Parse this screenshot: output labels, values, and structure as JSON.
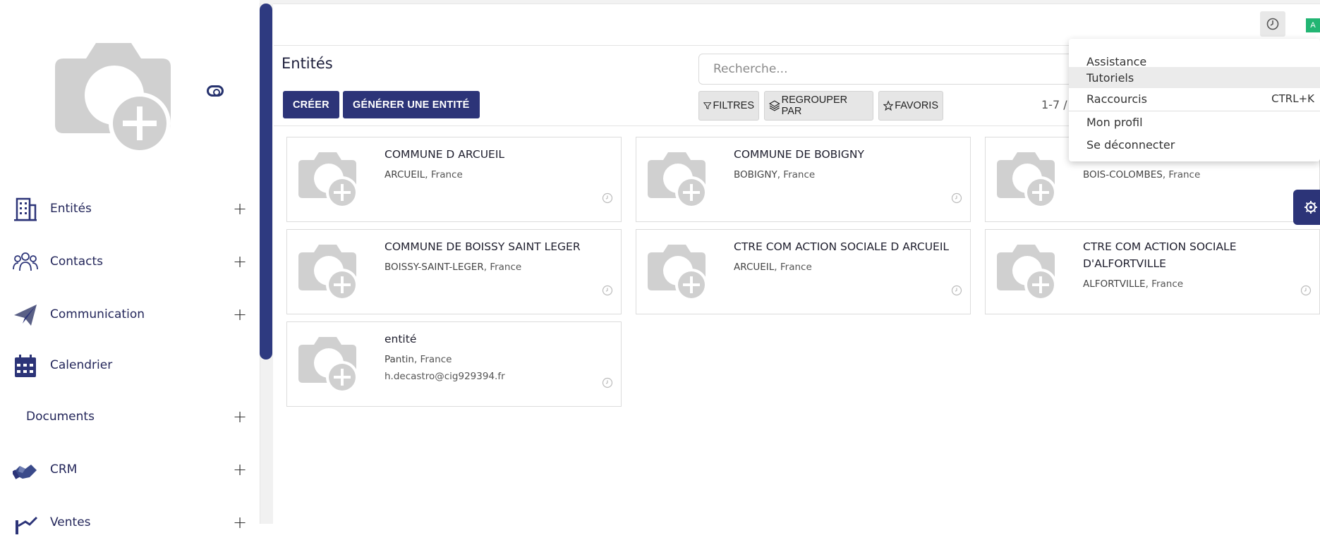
{
  "sidebar": {
    "items": [
      {
        "label": "Entités",
        "icon": "building-icon",
        "has_add": true
      },
      {
        "label": "Contacts",
        "icon": "people-icon",
        "has_add": true
      },
      {
        "label": "Communication",
        "icon": "paper-plane-icon",
        "has_add": true
      },
      {
        "label": "Calendrier",
        "icon": "calendar-icon",
        "has_add": false
      },
      {
        "label": "Documents",
        "icon": "",
        "has_add": true
      },
      {
        "label": "CRM",
        "icon": "handshake-icon",
        "has_add": true
      },
      {
        "label": "Ventes",
        "icon": "chart-icon",
        "has_add": true
      }
    ],
    "add_symbol": "+"
  },
  "main": {
    "title": "Entités",
    "create_label": "CRÉER",
    "generate_label": "GÉNÉRER UNE ENTITÉ",
    "search_placeholder": "Recherche...",
    "filters_label": "FILTRES",
    "group_label": "REGROUPER PAR",
    "favorites_label": "FAVORIS",
    "pager": "1-7 /"
  },
  "topbar": {
    "avatar_letter": "A"
  },
  "dropdown": {
    "items": [
      {
        "label": "Assistance"
      },
      {
        "label": "Tutoriels"
      },
      {
        "label": "Raccourcis",
        "shortcut": "CTRL+K"
      },
      {
        "label": "Mon profil"
      },
      {
        "label": "Se déconnecter"
      }
    ]
  },
  "cards": [
    {
      "name": "COMMUNE D ARCUEIL",
      "city": "ARCUEIL",
      "country": ", France"
    },
    {
      "name": "COMMUNE DE BOBIGNY",
      "city": "BOBIGNY",
      "country": ", France"
    },
    {
      "name": "",
      "city": "BOIS-COLOMBES",
      "country": ", France"
    },
    {
      "name": "COMMUNE DE BOISSY SAINT LEGER",
      "city": "BOISSY-SAINT-LEGER",
      "country": ", France"
    },
    {
      "name": "CTRE COM ACTION SOCIALE D ARCUEIL",
      "city": "ARCUEIL",
      "country": ", France"
    },
    {
      "name": "CTRE COM ACTION SOCIALE D'ALFORTVILLE",
      "city": "ALFORTVILLE",
      "country": ", France"
    },
    {
      "name": "entité",
      "city": "Pantin",
      "country": ", France",
      "email": "h.decastro@cig929394.fr"
    }
  ],
  "colors": {
    "primary": "#2c3478",
    "avatar": "#22b573",
    "placeholder_gray": "#d0d0d0"
  }
}
